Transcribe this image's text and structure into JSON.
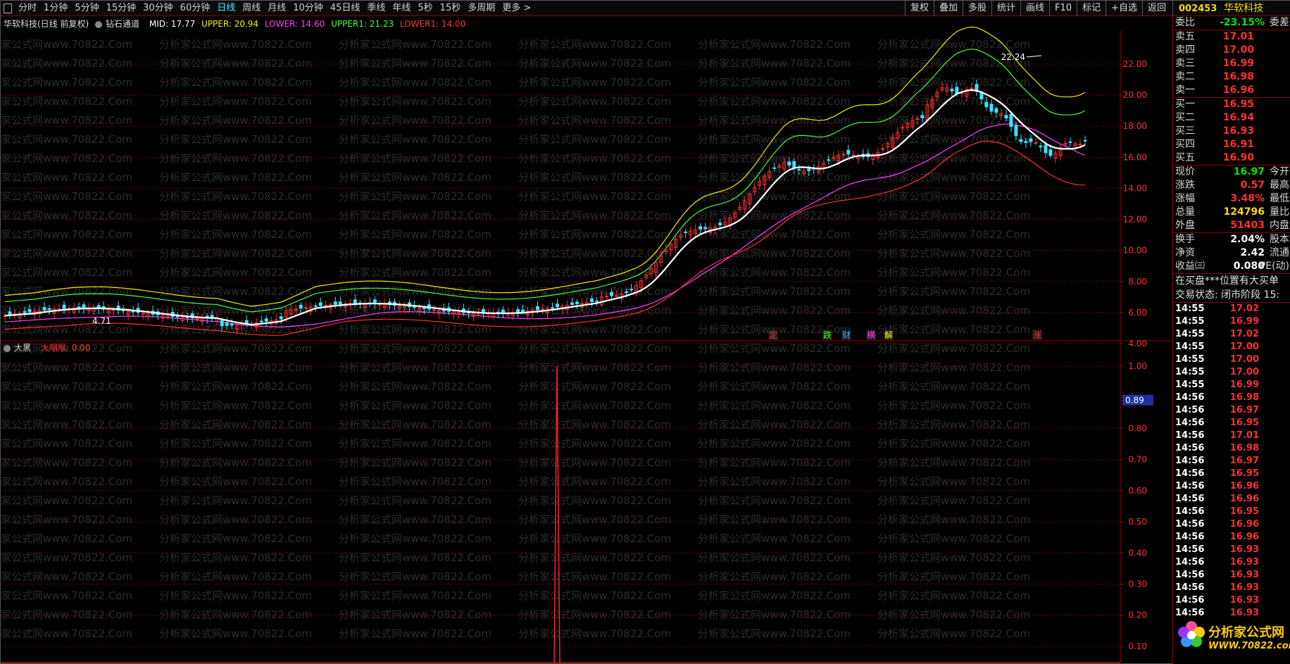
{
  "toolbar": {
    "periods": [
      "分时",
      "1分钟",
      "5分钟",
      "15分钟",
      "30分钟",
      "60分钟",
      "日线",
      "周线",
      "月线",
      "10分钟",
      "45日线",
      "季线",
      "年线",
      "5秒",
      "15秒",
      "多周期",
      "更多 >"
    ],
    "active_period": "日线",
    "tools": [
      "复权",
      "叠加",
      "多股",
      "统计",
      "画线",
      "F10",
      "标记",
      "+自选",
      "返回"
    ],
    "stock_code": "002453",
    "stock_name": "华软科技"
  },
  "main_legend": {
    "title": "华软科技(日线 前复权)",
    "indicator": "钻石通道",
    "mid": "MID: 17.77",
    "upper": "UPPER: 20.94",
    "lower": "LOWER: 14.60",
    "upper1": "UPPER1: 21.23",
    "lower1": "LOWER1: 14.00"
  },
  "sub_legend": {
    "title": "大黑",
    "value": "大咽喉: 0.00"
  },
  "price_axis": [
    "22.00",
    "20.00",
    "18.00",
    "16.00",
    "14.00",
    "12.00",
    "10.00",
    "8.00",
    "6.00",
    "4.00"
  ],
  "sub_axis": [
    "1.00",
    "0.89",
    "0.80",
    "0.70",
    "0.60",
    "0.50",
    "0.40",
    "0.30",
    "0.20",
    "0.10"
  ],
  "sub_axis_highlight": "0.89",
  "annotations": {
    "high_label": "22.24",
    "low_label": "4.71",
    "signals": [
      {
        "text": "定",
        "color": "#ff3030"
      },
      {
        "text": "跌",
        "color": "#40ff40"
      },
      {
        "text": "财",
        "color": "#40a0ff"
      },
      {
        "text": "横",
        "color": "#ff40ff"
      },
      {
        "text": "解",
        "color": "#ffff00"
      },
      {
        "text": "涨",
        "color": "#ff3030"
      }
    ]
  },
  "watermark": "分析家公式网www.70822.Com",
  "quote": {
    "weibi_label": "委比",
    "weibi_value": "-23.15%",
    "weicha_label": "委差",
    "sell": [
      {
        "label": "卖五",
        "price": "17.01"
      },
      {
        "label": "卖四",
        "price": "17.00"
      },
      {
        "label": "卖三",
        "price": "16.99"
      },
      {
        "label": "卖二",
        "price": "16.98"
      },
      {
        "label": "卖一",
        "price": "16.96"
      }
    ],
    "buy": [
      {
        "label": "买一",
        "price": "16.95"
      },
      {
        "label": "买二",
        "price": "16.94"
      },
      {
        "label": "买三",
        "price": "16.93"
      },
      {
        "label": "买四",
        "price": "16.91"
      },
      {
        "label": "买五",
        "price": "16.90"
      }
    ],
    "stats1": [
      {
        "label": "现价",
        "value": "16.97",
        "color": "v-green",
        "label2": "今开"
      },
      {
        "label": "涨跌",
        "value": "0.57",
        "color": "v-red",
        "label2": "最高"
      },
      {
        "label": "涨幅",
        "value": "3.48%",
        "color": "v-red",
        "label2": "最低"
      },
      {
        "label": "总量",
        "value": "124796",
        "color": "v-yellow",
        "label2": "量比"
      },
      {
        "label": "外盘",
        "value": "51403",
        "color": "v-red",
        "label2": "内盘"
      }
    ],
    "stats2": [
      {
        "label": "换手",
        "value": "2.04%",
        "color": "v-white",
        "label2": "股本"
      },
      {
        "label": "净资",
        "value": "2.42",
        "color": "v-white",
        "label2": "流通"
      },
      {
        "label": "收益㈢",
        "value": "0.080",
        "color": "v-white",
        "label2": "PE(动)"
      }
    ],
    "info1": "在买盘***位置有大买单",
    "info2": "交易状态: 闭市阶段 15:"
  },
  "ticks": [
    {
      "time": "14:55",
      "price": "17.02",
      "color": "v-red"
    },
    {
      "time": "14:55",
      "price": "16.99",
      "color": "v-red"
    },
    {
      "time": "14:55",
      "price": "17.02",
      "color": "v-red"
    },
    {
      "time": "14:55",
      "price": "17.00",
      "color": "v-red"
    },
    {
      "time": "14:55",
      "price": "17.00",
      "color": "v-red"
    },
    {
      "time": "14:55",
      "price": "17.00",
      "color": "v-red"
    },
    {
      "time": "14:55",
      "price": "16.99",
      "color": "v-red"
    },
    {
      "time": "14:56",
      "price": "16.98",
      "color": "v-red"
    },
    {
      "time": "14:56",
      "price": "16.97",
      "color": "v-red"
    },
    {
      "time": "14:56",
      "price": "16.95",
      "color": "v-red"
    },
    {
      "time": "14:56",
      "price": "17.01",
      "color": "v-red"
    },
    {
      "time": "14:56",
      "price": "16.98",
      "color": "v-red"
    },
    {
      "time": "14:56",
      "price": "16.97",
      "color": "v-red"
    },
    {
      "time": "14:56",
      "price": "16.95",
      "color": "v-red"
    },
    {
      "time": "14:56",
      "price": "16.96",
      "color": "v-red"
    },
    {
      "time": "14:56",
      "price": "16.96",
      "color": "v-red"
    },
    {
      "time": "14:56",
      "price": "16.95",
      "color": "v-red"
    },
    {
      "time": "14:56",
      "price": "16.96",
      "color": "v-red"
    },
    {
      "time": "14:56",
      "price": "16.96",
      "color": "v-red"
    },
    {
      "time": "14:56",
      "price": "16.93",
      "color": "v-red"
    },
    {
      "time": "14:56",
      "price": "16.93",
      "color": "v-red"
    },
    {
      "time": "14:56",
      "price": "16.93",
      "color": "v-red"
    },
    {
      "time": "14:56",
      "price": "16.93",
      "color": "v-red"
    },
    {
      "time": "14:56",
      "price": "16.93",
      "color": "v-red"
    },
    {
      "time": "14:56",
      "price": "16.93",
      "color": "v-red"
    }
  ],
  "logo": {
    "text": "分析家公式网",
    "url": "WWW.70822.com"
  },
  "colors": {
    "up": "#ff3030",
    "down": "#40e0ff",
    "mid": "#ffffff",
    "upper": "#f0f000",
    "upper1": "#40ff40",
    "lower": "#ff40ff",
    "lower1": "#ff3030",
    "grid": "#8a0000",
    "spike": "#ff2020"
  }
}
